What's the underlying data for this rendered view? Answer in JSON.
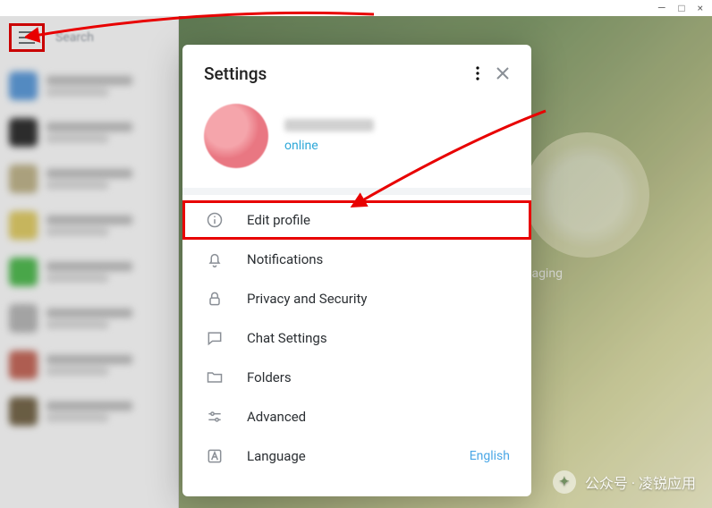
{
  "titlebar": {
    "min": "—",
    "max": "□",
    "close": "×"
  },
  "search": {
    "placeholder": "Search"
  },
  "settings": {
    "title": "Settings",
    "status": "online",
    "items": {
      "edit_profile": "Edit profile",
      "notifications": "Notifications",
      "privacy": "Privacy and Security",
      "chat": "Chat Settings",
      "folders": "Folders",
      "advanced": "Advanced",
      "language": "Language",
      "language_value": "English"
    }
  },
  "bg_text": "ssaging",
  "watermark": "公众号 · 凌锐应用"
}
